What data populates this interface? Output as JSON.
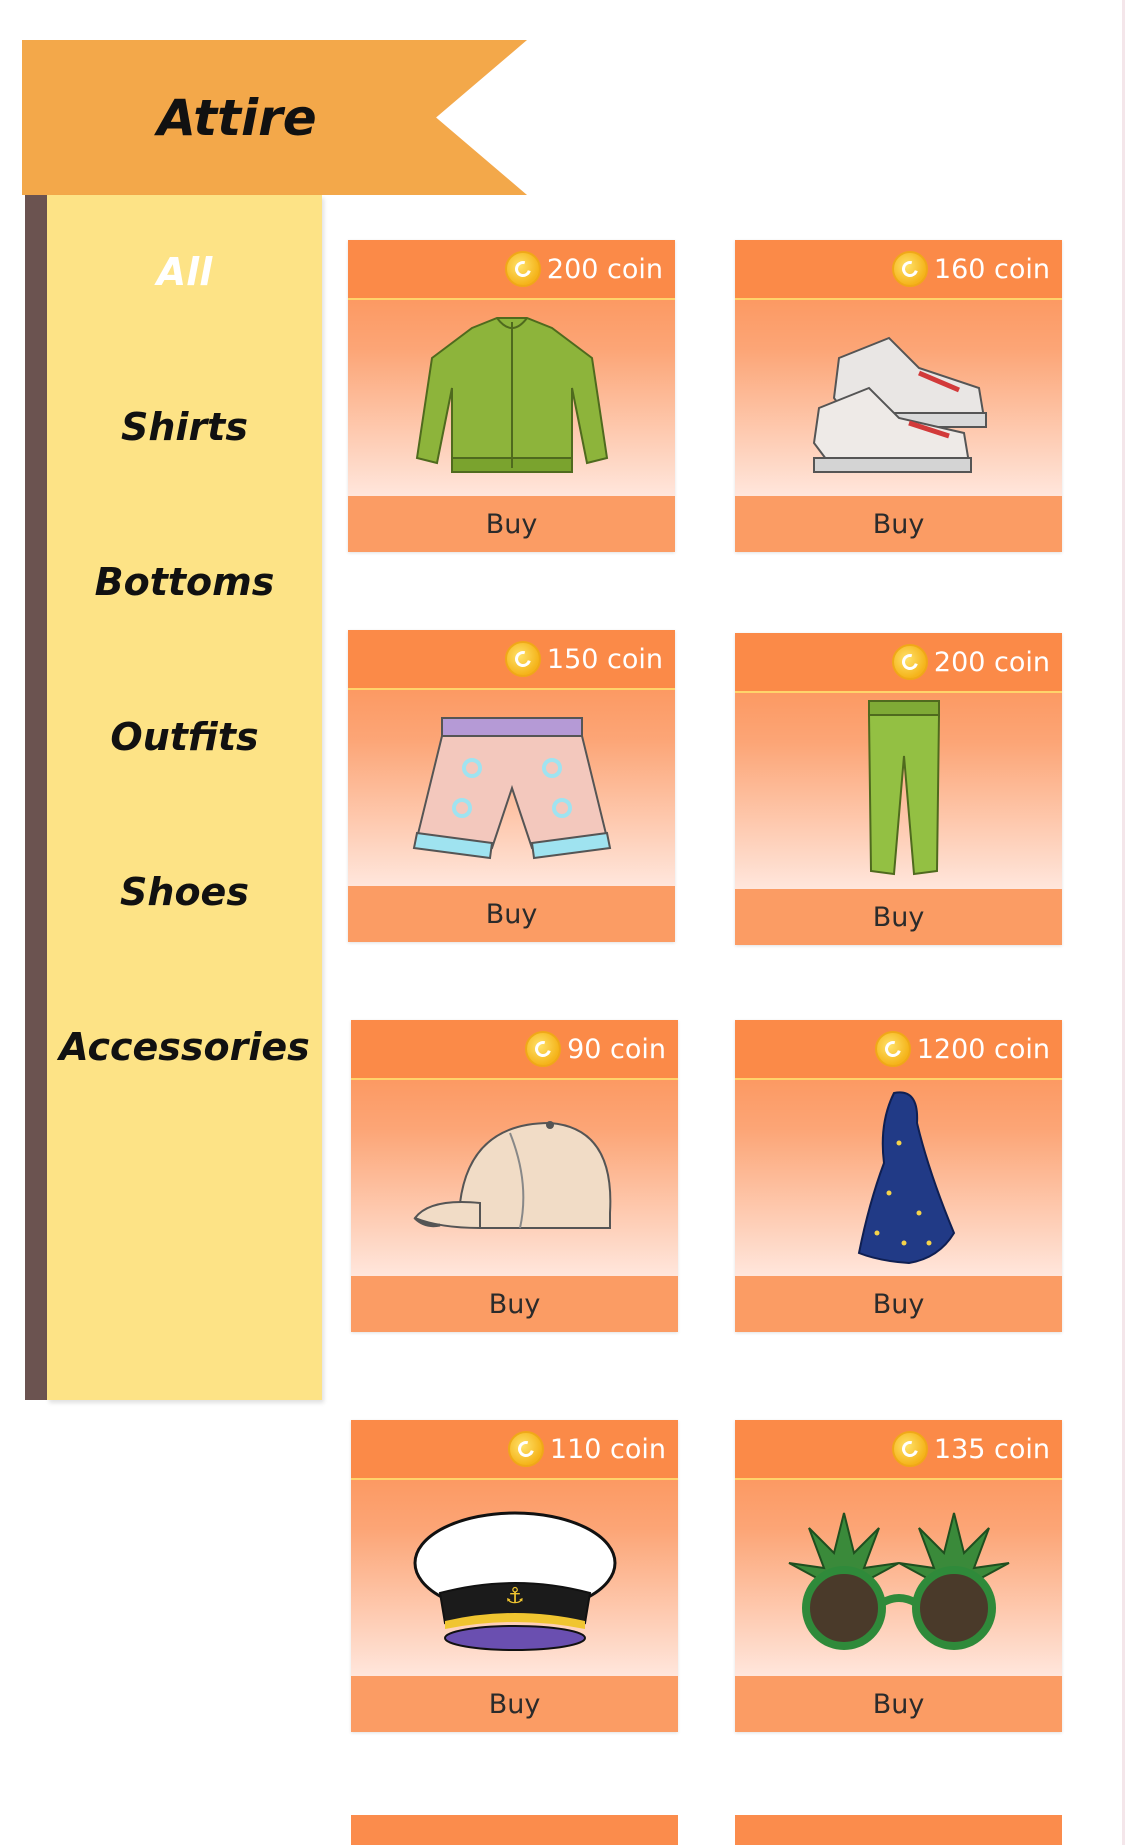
{
  "header": {
    "title": "Attire"
  },
  "categories": [
    {
      "label": "All",
      "active": true
    },
    {
      "label": "Shirts"
    },
    {
      "label": "Bottoms"
    },
    {
      "label": "Outfits"
    },
    {
      "label": "Shoes"
    },
    {
      "label": "Accessories"
    }
  ],
  "items": [
    {
      "price": "200 coin",
      "buy": "Buy",
      "art": "green-jacket"
    },
    {
      "price": "160 coin",
      "buy": "Buy",
      "art": "sneakers"
    },
    {
      "price": "150 coin",
      "buy": "Buy",
      "art": "shorts"
    },
    {
      "price": "200 coin",
      "buy": "Buy",
      "art": "green-pants"
    },
    {
      "price": "90 coin",
      "buy": "Buy",
      "art": "baseball-cap"
    },
    {
      "price": "1200 coin",
      "buy": "Buy",
      "art": "wizard-cloak"
    },
    {
      "price": "110 coin",
      "buy": "Buy",
      "art": "captain-hat"
    },
    {
      "price": "135 coin",
      "buy": "Buy",
      "art": "leaf-sunglasses"
    }
  ]
}
